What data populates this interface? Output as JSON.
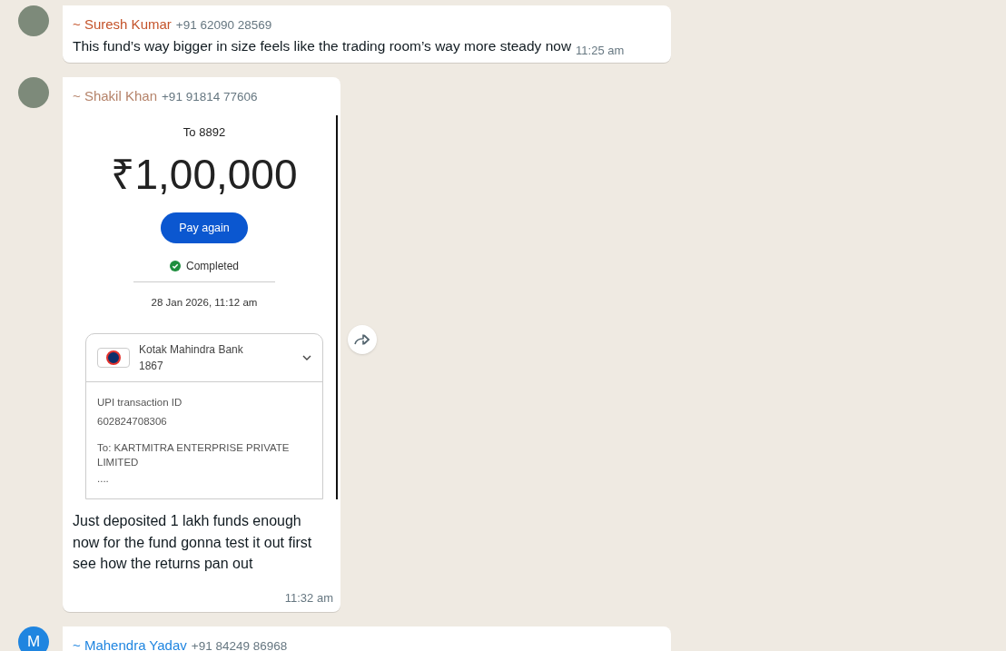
{
  "messages": [
    {
      "kind": "text",
      "avatar": {
        "kind": "photo"
      },
      "sender": {
        "name": "~ Suresh Kumar",
        "phone": "+91 62090 28569",
        "color": "#c4532a"
      },
      "text": "This fund’s way bigger in size feels like the trading room’s way more steady now",
      "time": "11:25 am"
    },
    {
      "kind": "image",
      "avatar": {
        "kind": "photo"
      },
      "sender": {
        "name": "~ Shakil Khan",
        "phone": "+91 91814 77606",
        "color": "#b5836a"
      },
      "image": {
        "to": "To 8892",
        "amount": "₹1,00,000",
        "button": "Pay again",
        "status": "Completed",
        "datetime": "28 Jan 2026, 11:12 am",
        "bank_name": "Kotak Mahindra Bank",
        "bank_account": "1867",
        "id_label": "UPI transaction ID",
        "id_value": "602824708306",
        "payee": "To: KARTMITRA ENTERPRISE PRIVATE LIMITED",
        "payee_account": "...."
      },
      "text": "Just deposited 1 lakh funds enough now for the fund gonna test it out first see how the returns pan out",
      "time": "11:32 am",
      "forward": true
    },
    {
      "kind": "text",
      "avatar": {
        "kind": "letter",
        "letter": "M"
      },
      "sender": {
        "name": "~ Mahendra Yadav",
        "phone": "+91 84249 86968",
        "color": "#1f85e0"
      }
    }
  ]
}
